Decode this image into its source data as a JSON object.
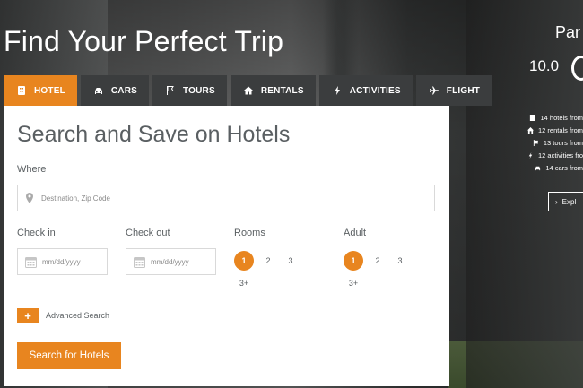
{
  "headline": "Find Your Perfect Trip",
  "tabs": [
    {
      "label": "HOTEL",
      "icon": "hotel-icon"
    },
    {
      "label": "CARS",
      "icon": "car-icon"
    },
    {
      "label": "TOURS",
      "icon": "flag-icon"
    },
    {
      "label": "RENTALS",
      "icon": "home-icon"
    },
    {
      "label": "ACTIVITIES",
      "icon": "bolt-icon"
    },
    {
      "label": "FLIGHT",
      "icon": "plane-icon"
    }
  ],
  "search": {
    "title": "Search and Save on Hotels",
    "where_label": "Where",
    "destination_placeholder": "Destination, Zip Code",
    "checkin_label": "Check in",
    "checkout_label": "Check out",
    "date_placeholder": "mm/dd/yyyy",
    "rooms_label": "Rooms",
    "adult_label": "Adult",
    "rooms_options": [
      "1",
      "2",
      "3",
      "3+"
    ],
    "rooms_selected": "1",
    "adult_options": [
      "1",
      "2",
      "3",
      "3+"
    ],
    "adult_selected": "1",
    "advanced_label": "Advanced Search",
    "advanced_symbol": "+",
    "submit_label": "Search for Hotels"
  },
  "sidebar": {
    "city": "Par",
    "score": "10.0",
    "stats": [
      "14 hotels from",
      "12 rentals from",
      "13 tours from",
      "12 activities fro",
      "14 cars from"
    ],
    "explore_label": "Expl",
    "explore_symbol": "›"
  },
  "colors": {
    "accent": "#e8851f",
    "tab_bg": "#3b3d3e",
    "panel_bg": "#ffffff",
    "text": "#5a5f62"
  }
}
